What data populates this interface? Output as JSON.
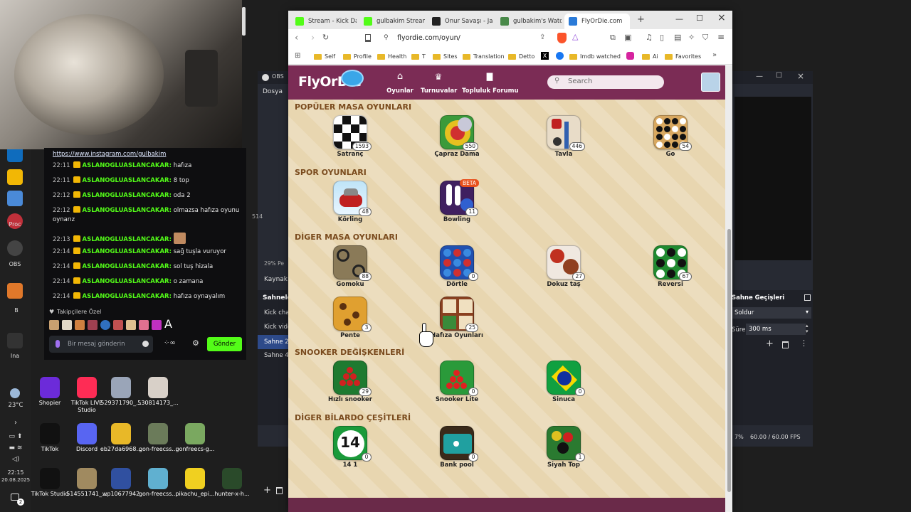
{
  "taskbar": {
    "weather": "23°C",
    "time": "22:15",
    "date": "20.08.2025",
    "notification_count": "2",
    "app_labels": [
      "Proc",
      "OBS",
      "B",
      "Ina"
    ]
  },
  "chat": {
    "link": "https://www.instagram.com/gulbakim",
    "messages": [
      {
        "time": "22:11",
        "user": "ASLANOGLUASLANCAKAR:",
        "text": "hafıza"
      },
      {
        "time": "22:11",
        "user": "ASLANOGLUASLANCAKAR:",
        "text": "8 top"
      },
      {
        "time": "22:12",
        "user": "ASLANOGLUASLANCAKAR:",
        "text": "oda 2"
      },
      {
        "time": "22:12",
        "user": "ASLANOGLUASLANCAKAR:",
        "text": "olmazsa hafıza oyunu oynarız"
      },
      {
        "time": "22:13",
        "user": "ASLANOGLUASLANCAKAR:",
        "text": ""
      },
      {
        "time": "22:14",
        "user": "ASLANOGLUASLANCAKAR:",
        "text": "sağ tuşla vuruyor"
      },
      {
        "time": "22:14",
        "user": "ASLANOGLUASLANCAKAR:",
        "text": "sol tuş hizala"
      },
      {
        "time": "22:14",
        "user": "ASLANOGLUASLANCAKAR:",
        "text": "o zamana"
      },
      {
        "time": "22:14",
        "user": "ASLANOGLUASLANCAKAR:",
        "text": "hafıza oynayalım"
      }
    ],
    "followers_label": "Takipçilere Özel",
    "emote_text": "A",
    "input_placeholder": "Bir mesaj gönderin",
    "send_label": "Gönder"
  },
  "desktop_icons": [
    {
      "label": "Shopier",
      "color": "#6c2bd9"
    },
    {
      "label": "TikTok LIVE Studio",
      "color": "#fe2c55"
    },
    {
      "label": "529371790_...",
      "color": "#9aa5b8"
    },
    {
      "label": "530814173_...",
      "color": "#d8d0c8"
    },
    {
      "label": "TikTok",
      "color": "#111111"
    },
    {
      "label": "Discord",
      "color": "#5865f2"
    },
    {
      "label": "eb27da6968...",
      "color": "#e8b828"
    },
    {
      "label": "gon-freecss...",
      "color": "#6b7b5a"
    },
    {
      "label": "gonfreecs-g...",
      "color": "#7aa860"
    },
    {
      "label": "TikTok Studio",
      "color": "#111111"
    },
    {
      "label": "514551741_...",
      "color": "#a08a60"
    },
    {
      "label": "wp10677942",
      "color": "#3050a0"
    },
    {
      "label": "gon-freecss...",
      "color": "#60b0d0"
    },
    {
      "label": "pikachu_epi...",
      "color": "#f0d020"
    },
    {
      "label": "hunter-x-h...",
      "color": "#2a4a2a"
    }
  ],
  "obs": {
    "title": "OBS",
    "menu_file": "Dosya",
    "zoom": "29%",
    "zoom_suffix": "Pe",
    "source_label": "Kaynak",
    "scenes_label": "Sahnele",
    "scenes": [
      "Kick chat",
      "Kick vide",
      "Sahne 2",
      "Sahne 4"
    ],
    "side_number": "514",
    "transitions_label": "Sahne Geçişleri",
    "transition_value": "Soldur",
    "duration_label": "Süre",
    "duration_value": "300 ms",
    "cpu": "7%",
    "fps": "60.00 / 60.00 FPS"
  },
  "browser": {
    "tabs": [
      {
        "label": "Stream - Kick Das",
        "color": "#53fc18"
      },
      {
        "label": "gulbakim Stream",
        "color": "#53fc18"
      },
      {
        "label": "Onur Savaşı - Jag",
        "color": "#222222"
      },
      {
        "label": "gulbakim's Watch",
        "color": "#4a8a4a"
      },
      {
        "label": "FlyOrDie.com",
        "color": "#2a7ad8"
      }
    ],
    "url": "flyordie.com/oyun/",
    "bookmarks": [
      "Self",
      "Profile",
      "Health",
      "T",
      "Sites",
      "Translation",
      "Detto",
      "Imdb watched",
      "Ai",
      "Favorites"
    ]
  },
  "site": {
    "logo": "FlyOrDie",
    "nav": [
      "Oyunlar",
      "Turnuvalar",
      "Topluluk Forumu"
    ],
    "search_placeholder": "Search",
    "sections": [
      {
        "title": "POPÜLER MASA OYUNLARI",
        "games": [
          {
            "name": "Satranç",
            "count": "1593",
            "icon": "chess"
          },
          {
            "name": "Çapraz Dama",
            "count": "550",
            "icon": "checkers"
          },
          {
            "name": "Tavla",
            "count": "446",
            "icon": "backgammon"
          },
          {
            "name": "Go",
            "count": "54",
            "icon": "go"
          }
        ]
      },
      {
        "title": "SPOR OYUNLARI",
        "games": [
          {
            "name": "Körling",
            "count": "48",
            "icon": "curling"
          },
          {
            "name": "Bowling",
            "count": "11",
            "icon": "bowling",
            "badge": "BETA"
          }
        ]
      },
      {
        "title": "DİGER MASA OYUNLARI",
        "games": [
          {
            "name": "Gomoku",
            "count": "88",
            "icon": "gomoku"
          },
          {
            "name": "Dörtle",
            "count": "0",
            "icon": "connect4"
          },
          {
            "name": "Dokuz taş",
            "count": "27",
            "icon": "ninemens"
          },
          {
            "name": "Reversi",
            "count": "67",
            "icon": "reversi"
          },
          {
            "name": "Pente",
            "count": "3",
            "icon": "pente"
          },
          {
            "name": "Hafıza Oyunları",
            "count": "25",
            "icon": "memory"
          }
        ]
      },
      {
        "title": "SNOOKER DEĞİŞKENLERİ",
        "games": [
          {
            "name": "Hızlı snooker",
            "count": "29",
            "icon": "snooker"
          },
          {
            "name": "Snooker Lite",
            "count": "0",
            "icon": "snookerlite"
          },
          {
            "name": "Sinuca",
            "count": "0",
            "icon": "sinuca"
          }
        ]
      },
      {
        "title": "DİGER BİLARDO ÇEŞİTLERİ",
        "games": [
          {
            "name": "14 1",
            "count": "0",
            "icon": "fourteen",
            "icon_text": "14"
          },
          {
            "name": "Bank pool",
            "count": "0",
            "icon": "bankpool"
          },
          {
            "name": "Siyah Top",
            "count": "1",
            "icon": "blackball"
          }
        ]
      }
    ]
  },
  "colors": {
    "site_header": "#7b2c55",
    "kick_green": "#53fc18",
    "accent_red": "#d64c4c"
  }
}
